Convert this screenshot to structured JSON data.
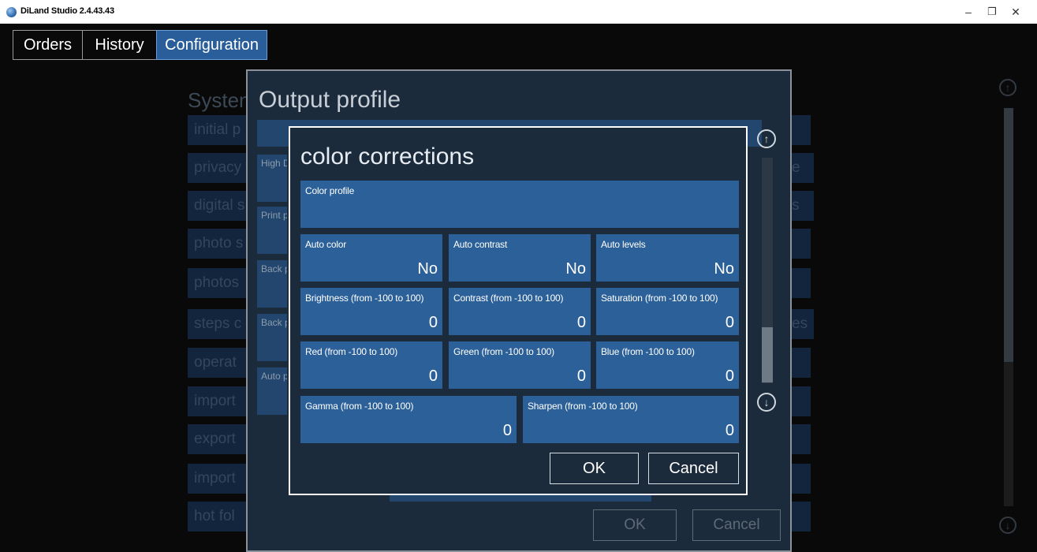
{
  "window": {
    "title": "DiLand Studio 2.4.43.43",
    "minimize": "–",
    "restore": "❐",
    "close": "✕"
  },
  "tabs": [
    {
      "label": "Orders"
    },
    {
      "label": "History"
    },
    {
      "label": "Configuration"
    }
  ],
  "background": {
    "section_title": "Systen",
    "items": [
      "initial p",
      "privacy",
      "digital s",
      "photo s",
      "photos",
      "steps c",
      "operat",
      "import",
      "export",
      "import",
      "hot fol"
    ],
    "right_fragments": [
      "e",
      "s",
      "es"
    ]
  },
  "output_profile": {
    "title": "Output profile",
    "rows": [
      "High D",
      "Print p",
      "Back p",
      "Back p",
      "Auto p"
    ],
    "ok_label": "OK",
    "cancel_label": "Cancel"
  },
  "color_corrections": {
    "title": "color corrections",
    "color_profile": {
      "label": "Color profile",
      "value": ""
    },
    "fields": [
      {
        "label": "Auto color",
        "value": "No"
      },
      {
        "label": "Auto contrast",
        "value": "No"
      },
      {
        "label": "Auto levels",
        "value": "No"
      },
      {
        "label": "Brightness (from -100 to 100)",
        "value": "0"
      },
      {
        "label": "Contrast (from -100 to 100)",
        "value": "0"
      },
      {
        "label": "Saturation (from -100 to 100)",
        "value": "0"
      },
      {
        "label": "Red (from -100 to 100)",
        "value": "0"
      },
      {
        "label": "Green (from -100 to 100)",
        "value": "0"
      },
      {
        "label": "Blue (from -100 to 100)",
        "value": "0"
      },
      {
        "label": "Gamma (from -100 to 100)",
        "value": "0"
      },
      {
        "label": "Sharpen (from -100 to 100)",
        "value": "0"
      }
    ],
    "ok_label": "OK",
    "cancel_label": "Cancel"
  },
  "icons": {
    "scroll_up": "arrow-up-circle-icon",
    "scroll_down": "arrow-down-circle-icon"
  },
  "colors": {
    "accent": "#2a5e9a",
    "field": "#2c6099",
    "dialog": "#1b2b3c"
  }
}
